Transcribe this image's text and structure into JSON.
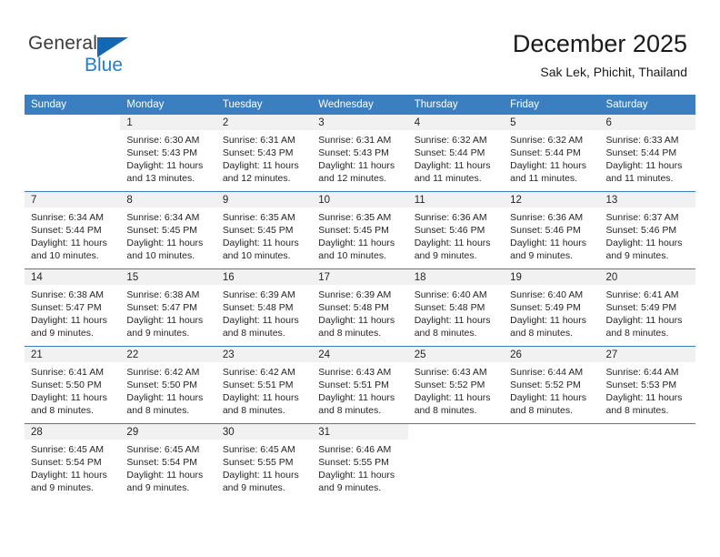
{
  "brand": {
    "line1": "General",
    "line2": "Blue",
    "triangle_color": "#1268b3",
    "blue_text_color": "#1e7fd4"
  },
  "header": {
    "title": "December 2025",
    "subtitle": "Sak Lek, Phichit, Thailand"
  },
  "theme": {
    "header_bar_color": "#3c7fc0",
    "daynum_band_color": "#f1f1f1",
    "row_divider_color": "#3c7fc0",
    "text_color": "#252525"
  },
  "weekday_headers": [
    "Sunday",
    "Monday",
    "Tuesday",
    "Wednesday",
    "Thursday",
    "Friday",
    "Saturday"
  ],
  "labels": {
    "sunrise_prefix": "Sunrise:",
    "sunset_prefix": "Sunset:",
    "daylight_prefix": "Daylight:"
  },
  "weeks": [
    [
      {
        "day": "",
        "blank": true
      },
      {
        "day": "1",
        "sunrise": "Sunrise: 6:30 AM",
        "sunset": "Sunset: 5:43 PM",
        "daylight": "Daylight: 11 hours and 13 minutes."
      },
      {
        "day": "2",
        "sunrise": "Sunrise: 6:31 AM",
        "sunset": "Sunset: 5:43 PM",
        "daylight": "Daylight: 11 hours and 12 minutes."
      },
      {
        "day": "3",
        "sunrise": "Sunrise: 6:31 AM",
        "sunset": "Sunset: 5:43 PM",
        "daylight": "Daylight: 11 hours and 12 minutes."
      },
      {
        "day": "4",
        "sunrise": "Sunrise: 6:32 AM",
        "sunset": "Sunset: 5:44 PM",
        "daylight": "Daylight: 11 hours and 11 minutes."
      },
      {
        "day": "5",
        "sunrise": "Sunrise: 6:32 AM",
        "sunset": "Sunset: 5:44 PM",
        "daylight": "Daylight: 11 hours and 11 minutes."
      },
      {
        "day": "6",
        "sunrise": "Sunrise: 6:33 AM",
        "sunset": "Sunset: 5:44 PM",
        "daylight": "Daylight: 11 hours and 11 minutes."
      }
    ],
    [
      {
        "day": "7",
        "sunrise": "Sunrise: 6:34 AM",
        "sunset": "Sunset: 5:44 PM",
        "daylight": "Daylight: 11 hours and 10 minutes."
      },
      {
        "day": "8",
        "sunrise": "Sunrise: 6:34 AM",
        "sunset": "Sunset: 5:45 PM",
        "daylight": "Daylight: 11 hours and 10 minutes."
      },
      {
        "day": "9",
        "sunrise": "Sunrise: 6:35 AM",
        "sunset": "Sunset: 5:45 PM",
        "daylight": "Daylight: 11 hours and 10 minutes."
      },
      {
        "day": "10",
        "sunrise": "Sunrise: 6:35 AM",
        "sunset": "Sunset: 5:45 PM",
        "daylight": "Daylight: 11 hours and 10 minutes."
      },
      {
        "day": "11",
        "sunrise": "Sunrise: 6:36 AM",
        "sunset": "Sunset: 5:46 PM",
        "daylight": "Daylight: 11 hours and 9 minutes."
      },
      {
        "day": "12",
        "sunrise": "Sunrise: 6:36 AM",
        "sunset": "Sunset: 5:46 PM",
        "daylight": "Daylight: 11 hours and 9 minutes."
      },
      {
        "day": "13",
        "sunrise": "Sunrise: 6:37 AM",
        "sunset": "Sunset: 5:46 PM",
        "daylight": "Daylight: 11 hours and 9 minutes."
      }
    ],
    [
      {
        "day": "14",
        "sunrise": "Sunrise: 6:38 AM",
        "sunset": "Sunset: 5:47 PM",
        "daylight": "Daylight: 11 hours and 9 minutes."
      },
      {
        "day": "15",
        "sunrise": "Sunrise: 6:38 AM",
        "sunset": "Sunset: 5:47 PM",
        "daylight": "Daylight: 11 hours and 9 minutes."
      },
      {
        "day": "16",
        "sunrise": "Sunrise: 6:39 AM",
        "sunset": "Sunset: 5:48 PM",
        "daylight": "Daylight: 11 hours and 8 minutes."
      },
      {
        "day": "17",
        "sunrise": "Sunrise: 6:39 AM",
        "sunset": "Sunset: 5:48 PM",
        "daylight": "Daylight: 11 hours and 8 minutes."
      },
      {
        "day": "18",
        "sunrise": "Sunrise: 6:40 AM",
        "sunset": "Sunset: 5:48 PM",
        "daylight": "Daylight: 11 hours and 8 minutes."
      },
      {
        "day": "19",
        "sunrise": "Sunrise: 6:40 AM",
        "sunset": "Sunset: 5:49 PM",
        "daylight": "Daylight: 11 hours and 8 minutes."
      },
      {
        "day": "20",
        "sunrise": "Sunrise: 6:41 AM",
        "sunset": "Sunset: 5:49 PM",
        "daylight": "Daylight: 11 hours and 8 minutes."
      }
    ],
    [
      {
        "day": "21",
        "sunrise": "Sunrise: 6:41 AM",
        "sunset": "Sunset: 5:50 PM",
        "daylight": "Daylight: 11 hours and 8 minutes."
      },
      {
        "day": "22",
        "sunrise": "Sunrise: 6:42 AM",
        "sunset": "Sunset: 5:50 PM",
        "daylight": "Daylight: 11 hours and 8 minutes."
      },
      {
        "day": "23",
        "sunrise": "Sunrise: 6:42 AM",
        "sunset": "Sunset: 5:51 PM",
        "daylight": "Daylight: 11 hours and 8 minutes."
      },
      {
        "day": "24",
        "sunrise": "Sunrise: 6:43 AM",
        "sunset": "Sunset: 5:51 PM",
        "daylight": "Daylight: 11 hours and 8 minutes."
      },
      {
        "day": "25",
        "sunrise": "Sunrise: 6:43 AM",
        "sunset": "Sunset: 5:52 PM",
        "daylight": "Daylight: 11 hours and 8 minutes."
      },
      {
        "day": "26",
        "sunrise": "Sunrise: 6:44 AM",
        "sunset": "Sunset: 5:52 PM",
        "daylight": "Daylight: 11 hours and 8 minutes."
      },
      {
        "day": "27",
        "sunrise": "Sunrise: 6:44 AM",
        "sunset": "Sunset: 5:53 PM",
        "daylight": "Daylight: 11 hours and 8 minutes."
      }
    ],
    [
      {
        "day": "28",
        "sunrise": "Sunrise: 6:45 AM",
        "sunset": "Sunset: 5:54 PM",
        "daylight": "Daylight: 11 hours and 9 minutes."
      },
      {
        "day": "29",
        "sunrise": "Sunrise: 6:45 AM",
        "sunset": "Sunset: 5:54 PM",
        "daylight": "Daylight: 11 hours and 9 minutes."
      },
      {
        "day": "30",
        "sunrise": "Sunrise: 6:45 AM",
        "sunset": "Sunset: 5:55 PM",
        "daylight": "Daylight: 11 hours and 9 minutes."
      },
      {
        "day": "31",
        "sunrise": "Sunrise: 6:46 AM",
        "sunset": "Sunset: 5:55 PM",
        "daylight": "Daylight: 11 hours and 9 minutes."
      },
      {
        "day": "",
        "blank": true
      },
      {
        "day": "",
        "blank": true
      },
      {
        "day": "",
        "blank": true
      }
    ]
  ]
}
